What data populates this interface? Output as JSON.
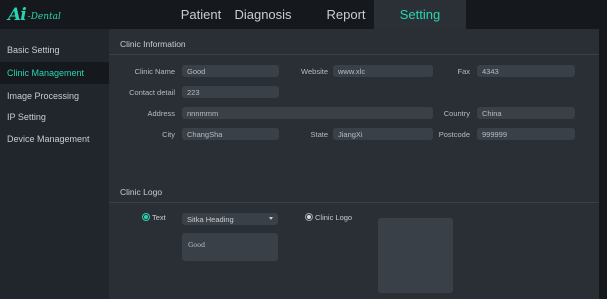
{
  "app": {
    "logo_ai": "Ai",
    "logo_text": "-Dental"
  },
  "tabs": [
    {
      "label": "Patient"
    },
    {
      "label": "Diagnosis"
    },
    {
      "label": "Report"
    },
    {
      "label": "Setting",
      "active": true
    }
  ],
  "sidebar": {
    "items": [
      {
        "label": "Basic Setting"
      },
      {
        "label": "Clinic Management",
        "active": true
      },
      {
        "label": "Image Processing"
      },
      {
        "label": "IP Setting"
      },
      {
        "label": "Device Management"
      }
    ]
  },
  "clinic_info": {
    "title": "Clinic Information",
    "clinic_name": {
      "label": "Clinic Name",
      "value": "Good"
    },
    "website": {
      "label": "Website",
      "value": "www.xlc"
    },
    "fax": {
      "label": "Fax",
      "value": "4343"
    },
    "contact_detail": {
      "label": "Contact detail",
      "value": "223"
    },
    "address": {
      "label": "Address",
      "value": "nnnmmm"
    },
    "country": {
      "label": "Country",
      "value": "China"
    },
    "city": {
      "label": "City",
      "value": "ChangSha"
    },
    "state": {
      "label": "State",
      "value": "JiangXi"
    },
    "postcode": {
      "label": "Postcode",
      "value": "999999"
    }
  },
  "clinic_logo": {
    "title": "Clinic Logo",
    "text_option": {
      "label": "Text",
      "selected": true
    },
    "font_select": {
      "value": "Sitka Heading"
    },
    "text_preview": "Good",
    "logo_option": {
      "label": "Clinic Logo",
      "selected": false
    }
  },
  "colors": {
    "accent": "#2bd4b0",
    "background": "#15191d",
    "sidebar": "#21262c",
    "panel": "#2a2f35",
    "field": "#3a4048"
  }
}
